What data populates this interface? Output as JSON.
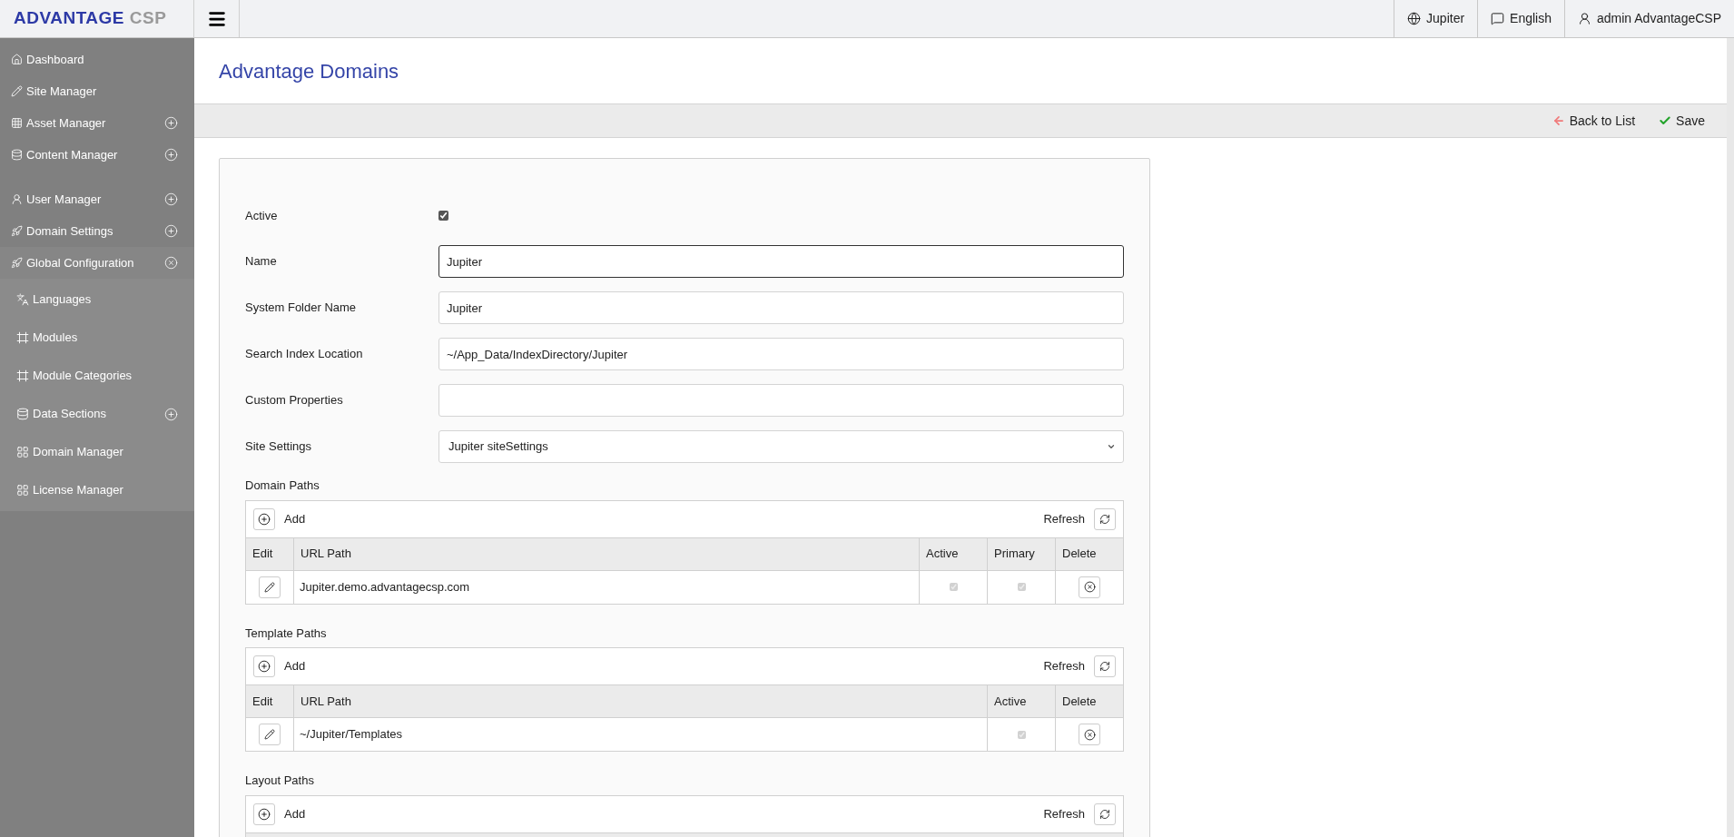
{
  "header": {
    "logo": {
      "primary": "ADVANTAGE",
      "secondary": "CSP"
    },
    "right_items": [
      {
        "label": "Jupiter"
      },
      {
        "label": "English"
      },
      {
        "label": "admin AdvantageCSP"
      }
    ]
  },
  "sidebar": {
    "sections": [
      [
        {
          "label": "Dashboard"
        },
        {
          "label": "Site Manager"
        },
        {
          "label": "Asset Manager",
          "expanded": false
        },
        {
          "label": "Content Manager",
          "expanded": false
        }
      ],
      [
        {
          "label": "User Manager",
          "expanded": false
        },
        {
          "label": "Domain Settings",
          "expanded": false
        },
        {
          "label": "Global Configuration",
          "expanded": true,
          "children": [
            {
              "label": "Languages"
            },
            {
              "label": "Modules"
            },
            {
              "label": "Module Categories"
            },
            {
              "label": "Data Sections",
              "expanded": false
            },
            {
              "label": "Domain Manager"
            },
            {
              "label": "License Manager"
            }
          ]
        }
      ]
    ]
  },
  "page": {
    "title": "Advantage Domains",
    "toolbar": [
      {
        "kind": "back",
        "label": "Back to List"
      },
      {
        "kind": "save",
        "label": "Save"
      }
    ]
  },
  "form": {
    "fields": [
      {
        "kind": "checkbox",
        "label": "Active",
        "checked": true
      },
      {
        "kind": "text",
        "label": "Name",
        "value": "Jupiter",
        "focused": true
      },
      {
        "kind": "text",
        "label": "System Folder Name",
        "value": "Jupiter",
        "focused": false
      },
      {
        "kind": "text",
        "label": "Search Index Location",
        "value": "~/App_Data/IndexDirectory/Jupiter",
        "focused": false
      },
      {
        "kind": "text",
        "label": "Custom Properties",
        "focused": false
      },
      {
        "kind": "select",
        "label": "Site Settings",
        "value": "Jupiter siteSettings"
      }
    ]
  },
  "path_tables": [
    {
      "title": "Domain Paths",
      "add_label": "Add",
      "refresh_label": "Refresh",
      "columns": [
        {
          "kind": "edit",
          "label": "Edit"
        },
        {
          "kind": "text",
          "label": "URL Path"
        },
        {
          "kind": "check",
          "label": "Active"
        },
        {
          "kind": "check",
          "label": "Primary"
        },
        {
          "kind": "delete",
          "label": "Delete"
        }
      ],
      "rows": [
        {
          "cells": [
            {
              "kind": "edit"
            },
            {
              "kind": "text",
              "text": "Jupiter.demo.advantagecsp.com"
            },
            {
              "kind": "check",
              "checked": true
            },
            {
              "kind": "check",
              "checked": true
            },
            {
              "kind": "delete"
            }
          ]
        }
      ]
    },
    {
      "title": "Template Paths",
      "add_label": "Add",
      "refresh_label": "Refresh",
      "columns": [
        {
          "kind": "edit",
          "label": "Edit"
        },
        {
          "kind": "text",
          "label": "URL Path"
        },
        {
          "kind": "check",
          "label": "Active"
        },
        {
          "kind": "delete",
          "label": "Delete"
        }
      ],
      "rows": [
        {
          "cells": [
            {
              "kind": "edit"
            },
            {
              "kind": "text",
              "text": "~/Jupiter/Templates"
            },
            {
              "kind": "check",
              "checked": true
            },
            {
              "kind": "delete"
            }
          ]
        }
      ]
    },
    {
      "title": "Layout Paths",
      "add_label": "Add",
      "refresh_label": "Refresh"
    }
  ]
}
